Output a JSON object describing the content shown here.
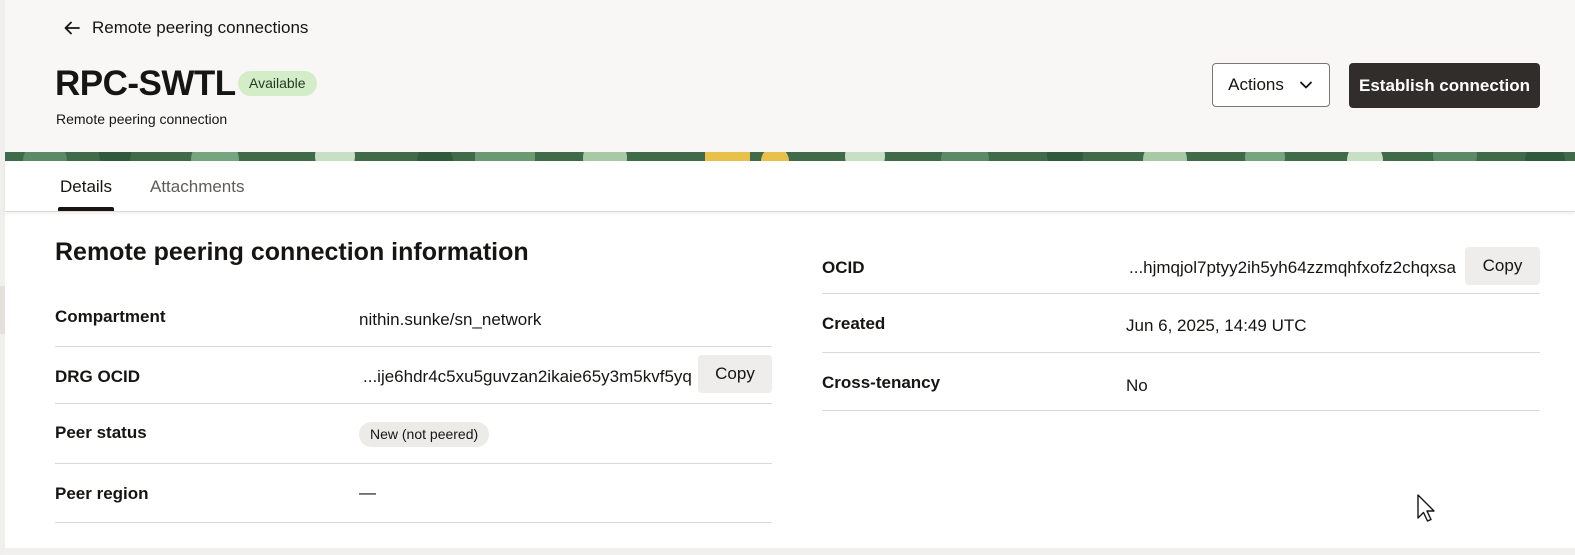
{
  "header": {
    "back_label": "Remote peering connections",
    "title": "RPC-SWTL",
    "status_badge": "Available",
    "subtitle": "Remote peering connection",
    "actions_label": "Actions",
    "primary_action_label": "Establish connection"
  },
  "tabs": [
    {
      "label": "Details",
      "selected": true
    },
    {
      "label": "Attachments",
      "selected": false
    }
  ],
  "info": {
    "section_title": "Remote peering connection information",
    "left": {
      "compartment": {
        "label": "Compartment",
        "value": "nithin.sunke/sn_network"
      },
      "drg_ocid": {
        "label": "DRG OCID",
        "value": "...ije6hdr4c5xu5guvzan2ikaie65y3m5kvf5yq",
        "copy_label": "Copy"
      },
      "peer_status": {
        "label": "Peer status",
        "value": "New (not peered)"
      },
      "peer_region": {
        "label": "Peer region",
        "value": "—"
      }
    },
    "right": {
      "ocid": {
        "label": "OCID",
        "value": "...hjmqjol7ptyy2ih5yh64zzmqhfxofz2chqxsa",
        "copy_label": "Copy"
      },
      "created": {
        "label": "Created",
        "value": "Jun 6, 2025, 14:49 UTC"
      },
      "cross_tenancy": {
        "label": "Cross-tenancy",
        "value": "No"
      }
    }
  },
  "colors": {
    "primary_button": "#312d2a",
    "available_badge": "#d4edc9",
    "banner_green": "#3f6b4b",
    "header_background": "#f8f7f5"
  },
  "icons": [
    "arrow-left-icon",
    "chevron-down-icon",
    "mouse-pointer-icon"
  ]
}
